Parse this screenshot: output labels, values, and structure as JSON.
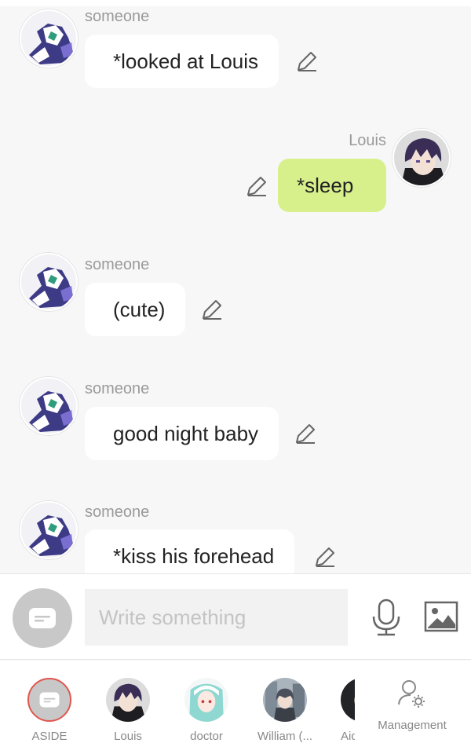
{
  "messages": [
    {
      "sender": "someone",
      "text": "*looked at Louis",
      "side": "left"
    },
    {
      "sender": "Louis",
      "text": "*sleep",
      "side": "right"
    },
    {
      "sender": "someone",
      "text": "(cute)",
      "side": "left"
    },
    {
      "sender": "someone",
      "text": "good night baby",
      "side": "left"
    },
    {
      "sender": "someone",
      "text": "*kiss his forehead",
      "side": "left"
    }
  ],
  "composer": {
    "placeholder": "Write something"
  },
  "tabbar": {
    "tabs": [
      {
        "label": "ASIDE"
      },
      {
        "label": "Louis"
      },
      {
        "label": "doctor"
      },
      {
        "label": "William (..."
      },
      {
        "label": "Aid"
      }
    ],
    "management_label": "Management"
  },
  "colors": {
    "background": "#f7f7f7",
    "own_bubble": "#d7f08b",
    "other_bubble": "#ffffff",
    "aside_ring": "#e0574f"
  },
  "icons": {
    "edit": "pencil-icon",
    "mode": "aside-note-icon",
    "mic": "microphone-icon",
    "image": "image-icon",
    "management": "user-gear-icon"
  }
}
